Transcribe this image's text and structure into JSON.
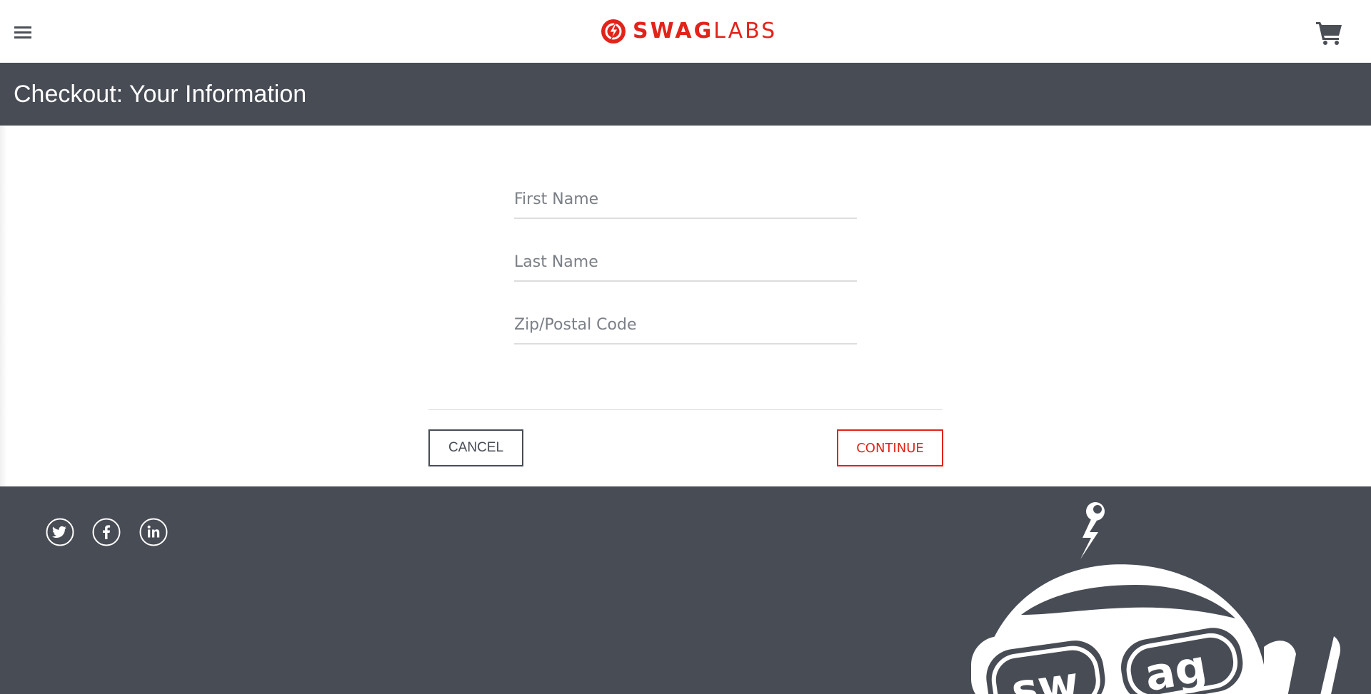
{
  "header": {
    "menu_icon": "hamburger-menu-icon",
    "logo": {
      "bold": "SWAG",
      "light": "LABS",
      "brand_color": "#e2231a"
    },
    "cart_icon": "shopping-cart-icon"
  },
  "title_bar": {
    "title": "Checkout: Your Information",
    "background": "#474c55"
  },
  "form": {
    "first_name": {
      "value": "",
      "placeholder": "First Name"
    },
    "last_name": {
      "value": "",
      "placeholder": "Last Name"
    },
    "postal_code": {
      "value": "",
      "placeholder": "Zip/Postal Code"
    }
  },
  "actions": {
    "cancel_label": "CANCEL",
    "continue_label": "CONTINUE"
  },
  "footer": {
    "social": [
      "twitter-icon",
      "facebook-icon",
      "linkedin-icon"
    ],
    "mascot": "swag-robot-mascot"
  }
}
